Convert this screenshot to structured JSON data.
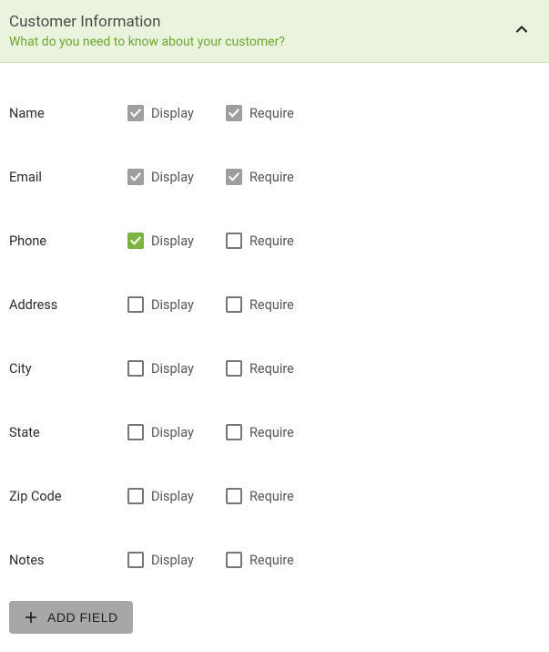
{
  "header": {
    "title": "Customer Information",
    "subtitle": "What do you need to know about your customer?"
  },
  "labels": {
    "display": "Display",
    "require": "Require"
  },
  "fields": [
    {
      "name": "Name",
      "display": true,
      "display_locked": true,
      "require": true,
      "require_locked": true
    },
    {
      "name": "Email",
      "display": true,
      "display_locked": true,
      "require": true,
      "require_locked": true
    },
    {
      "name": "Phone",
      "display": true,
      "display_locked": false,
      "require": false,
      "require_locked": false
    },
    {
      "name": "Address",
      "display": false,
      "display_locked": false,
      "require": false,
      "require_locked": false
    },
    {
      "name": "City",
      "display": false,
      "display_locked": false,
      "require": false,
      "require_locked": false
    },
    {
      "name": "State",
      "display": false,
      "display_locked": false,
      "require": false,
      "require_locked": false
    },
    {
      "name": "Zip Code",
      "display": false,
      "display_locked": false,
      "require": false,
      "require_locked": false
    },
    {
      "name": "Notes",
      "display": false,
      "display_locked": false,
      "require": false,
      "require_locked": false
    }
  ],
  "add_field_label": "ADD FIELD"
}
